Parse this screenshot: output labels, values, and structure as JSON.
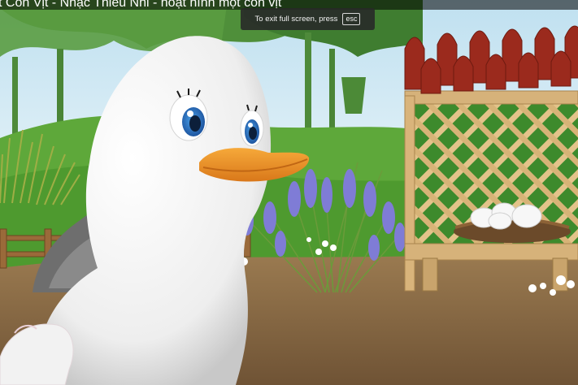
{
  "video": {
    "title": "t Con Vịt - Nhạc Thiếu Nhi - hoạt hình một con vịt"
  },
  "fullscreen_toast": {
    "message": "To exit full screen, press",
    "key": "esc"
  },
  "colors": {
    "sky": "#cfe6f2",
    "grass": "#5ea83a",
    "ground": "#8a6a45",
    "roof_tile": "#9b2a1d",
    "lattice": "#e8c890",
    "lavender": "#7f7cd6",
    "duck_white": "#f4f4f4",
    "duck_beak": "#f0972a",
    "duck_eye": "#2e78c8"
  }
}
